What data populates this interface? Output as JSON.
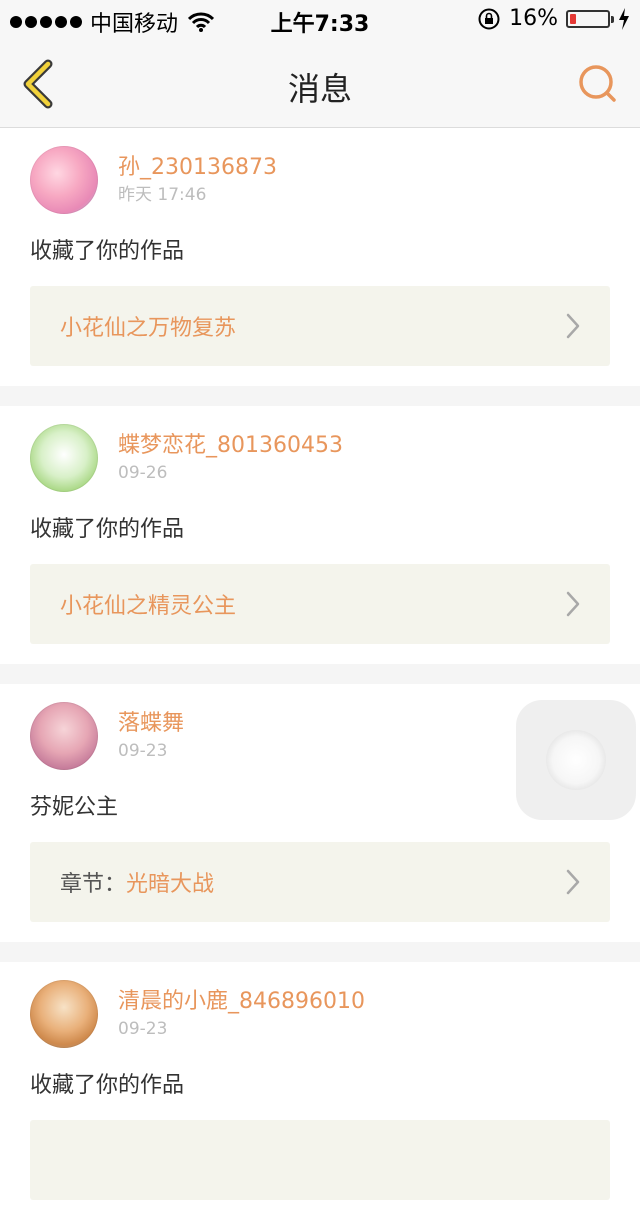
{
  "status_bar": {
    "carrier": "中国移动",
    "time": "上午7:33",
    "battery_percent": "16%",
    "battery_level": 0.16,
    "icons": [
      "signal-dots-icon",
      "wifi-icon",
      "orientation-lock-icon",
      "battery-icon",
      "charging-icon"
    ]
  },
  "nav": {
    "title": "消息",
    "back_icon": "back-chevron-icon",
    "search_icon": "search-icon",
    "accent_color": "#e8965c"
  },
  "messages": [
    {
      "username": "孙_230136873",
      "time": "昨天 17:46",
      "text": "收藏了你的作品",
      "link_prefix": "",
      "link_title": "小花仙之万物复苏"
    },
    {
      "username": "蝶梦恋花_801360453",
      "time": "09-26",
      "text": "收藏了你的作品",
      "link_prefix": "",
      "link_title": "小花仙之精灵公主"
    },
    {
      "username": "落蝶舞",
      "time": "09-23",
      "text": "芬妮公主",
      "link_prefix": "章节：",
      "link_title": "光暗大战"
    },
    {
      "username": "清晨的小鹿_846896010",
      "time": "09-23",
      "text": "收藏了你的作品",
      "link_prefix": "",
      "link_title": ""
    }
  ]
}
